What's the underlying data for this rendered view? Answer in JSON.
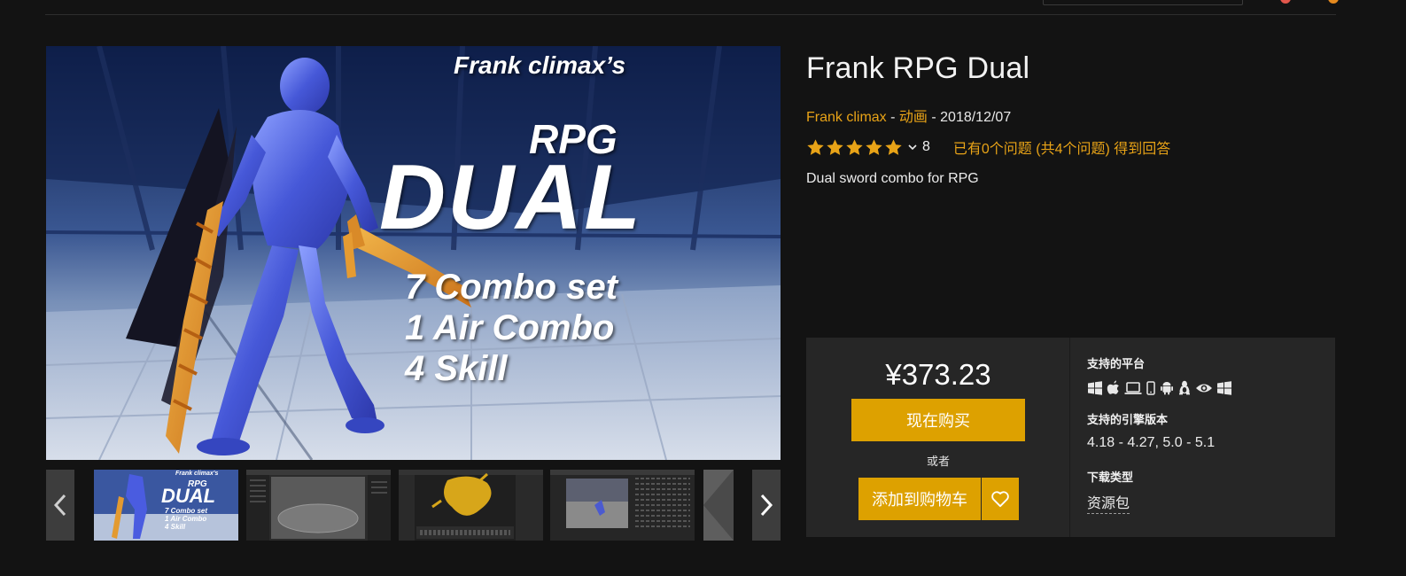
{
  "product": {
    "title": "Frank RPG Dual",
    "author": "Frank climax",
    "separator1": " - ",
    "category": "动画",
    "separator2": " - ",
    "date": "2018/12/07",
    "rating_count": "8",
    "rating_stars": 5,
    "qa_text": "已有0个问题 (共4个问题) 得到回答",
    "description": "Dual sword combo for RPG"
  },
  "hero": {
    "author_line": "Frank climax’s",
    "rpg": "RPG",
    "dual": "DUAL",
    "line1": "7  Combo set",
    "line2": "1  Air Combo",
    "line3": "4  Skill"
  },
  "thumb1": {
    "author_line": "Frank climax's",
    "rpg": "RPG",
    "dual": "DUAL",
    "line1": "7 Combo set",
    "line2": "1 Air Combo",
    "line3": "4 Skill"
  },
  "purchase": {
    "price": "¥373.23",
    "buy_now": "现在购买",
    "or": "或者",
    "add_to_cart": "添加到购物车"
  },
  "specs": {
    "platforms_heading": "支持的平台",
    "platform_icons": [
      "windows-icon",
      "apple-icon",
      "laptop-icon",
      "phone-icon",
      "android-icon",
      "linux-icon",
      "eye-icon",
      "windows-icon"
    ],
    "engine_heading": "支持的引擎版本",
    "engine_versions": "4.18 - 4.27, 5.0 - 5.1",
    "download_heading": "下载类型",
    "download_type": "资源包"
  },
  "colors": {
    "accent": "#dda100",
    "link": "#e8a317",
    "background": "#131313",
    "panel": "#262626"
  }
}
